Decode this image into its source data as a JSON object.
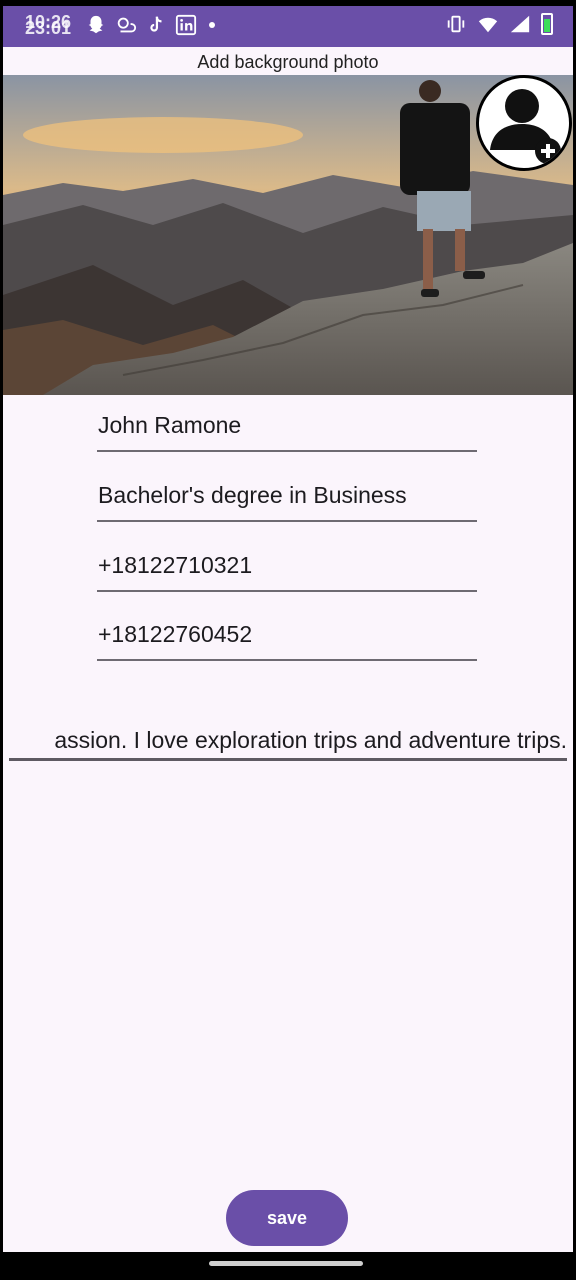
{
  "status_bar": {
    "time_a": "10:26",
    "time_b": "23:01",
    "icons": [
      "snapchat-icon",
      "weather-cloud-icon",
      "tiktok-icon",
      "linkedin-icon",
      "notification-dot",
      "vibrate-icon",
      "wifi-icon",
      "signal-icon",
      "battery-icon"
    ]
  },
  "header": {
    "add_background_label": "Add background photo"
  },
  "profile": {
    "background_photo": "mountain-hiker-sunset",
    "avatar_icon": "add-user-icon"
  },
  "form": {
    "name": "John Ramone",
    "education": "Bachelor's degree in Business",
    "phone_1": "+18122710321",
    "phone_2": "+18122760452",
    "bio": "assion. I love exploration trips and adventure trips."
  },
  "actions": {
    "save_label": "save"
  },
  "colors": {
    "accent": "#6a4fa8",
    "background": "#fbf5fc",
    "underline": "#6e6a72"
  }
}
